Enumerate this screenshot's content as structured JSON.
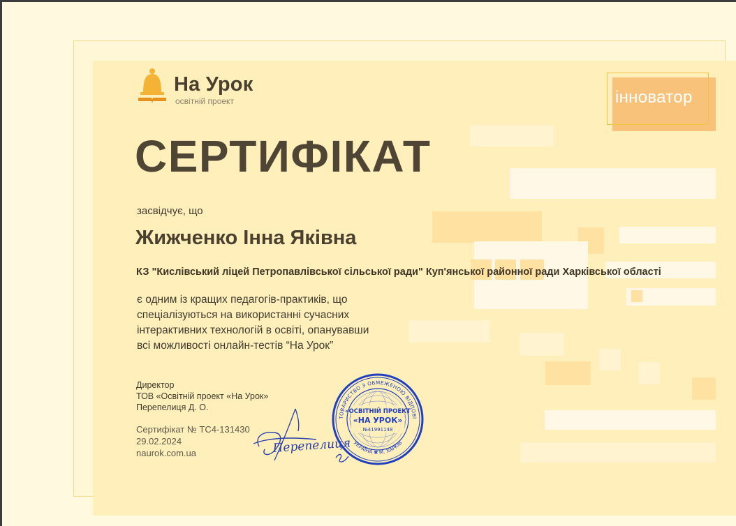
{
  "logo": {
    "title": "На Урок",
    "subtitle": "освітній проект",
    "icon": "bell-book-icon"
  },
  "badge": {
    "label": "інноватор"
  },
  "certificate": {
    "title": "СЕРТИФІКАТ",
    "certifies": "засвідчує, що",
    "recipient": "Жижченко Інна Яківна",
    "organization": "КЗ \"Кислівський ліцей Петропавлівської сільської ради\" Куп'янської районної ради Харківської області",
    "description_lines": [
      "є одним із кращих педагогів-практиків, що",
      "спеціалізуються на використанні сучасних",
      "інтерактивних технологій в освіті, опанувавши",
      "всі можливості онлайн-тестів “На Урок”"
    ]
  },
  "signer": {
    "role": "Директор",
    "company": "ТОВ  «Освітній проект «На Урок»",
    "name": "Перепелиця Д. О."
  },
  "meta": {
    "cert_number": "Сертифікат № ТС4-131430",
    "date": "29.02.2024",
    "website": "naurok.com.ua"
  },
  "stamp": {
    "center_line1": "«ОСВІТНІЙ ПРОЕКТ",
    "center_line2": "«НА УРОК»",
    "code": "№41991148",
    "ring_text": "ТОВАРИСТВО З ОБМЕЖЕНОЮ ВІДПОВІДАЛЬНІСТЮ",
    "bottom_text": "УКРАЇНА ✱ М. ХАРКІВ"
  },
  "signature_text": "Перепелиця",
  "colors": {
    "background": "#fff9e0",
    "panel": "#fff0bb",
    "accent": "#f5b335",
    "text_dark": "#4a4030",
    "stamp_blue": "#1f3fbf"
  }
}
